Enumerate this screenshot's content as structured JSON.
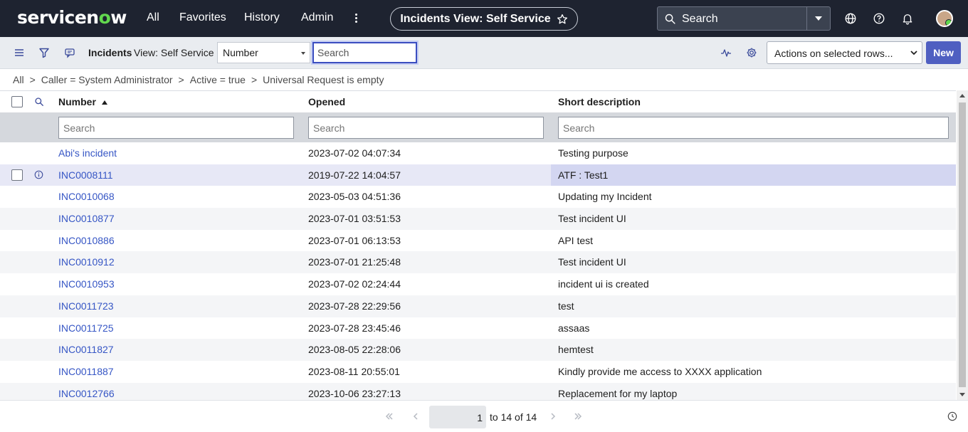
{
  "nav": {
    "logo_pre": "servicen",
    "logo_o": "o",
    "logo_post": "w",
    "links": [
      "All",
      "Favorites",
      "History",
      "Admin"
    ],
    "title": "Incidents View: Self Service",
    "search_placeholder": "Search"
  },
  "listbar": {
    "title": "Incidents",
    "view": "View: Self Service",
    "field_select": "Number",
    "search_placeholder": "Search",
    "actions_select": "Actions on selected rows...",
    "new_label": "New"
  },
  "breadcrumb": [
    "All",
    "Caller = System Administrator",
    "Active = true",
    "Universal Request is empty"
  ],
  "table": {
    "columns": [
      "Number",
      "Opened",
      "Short description"
    ],
    "filter_placeholders": [
      "Search",
      "Search",
      "Search"
    ],
    "rows": [
      {
        "number": "Abi's incident",
        "opened": "2023-07-02 04:07:34",
        "desc": "Testing purpose"
      },
      {
        "number": "INC0008111",
        "opened": "2019-07-22 14:04:57",
        "desc": "ATF : Test1"
      },
      {
        "number": "INC0010068",
        "opened": "2023-05-03 04:51:36",
        "desc": "Updating my Incident"
      },
      {
        "number": "INC0010877",
        "opened": "2023-07-01 03:51:53",
        "desc": "Test incident UI"
      },
      {
        "number": "INC0010886",
        "opened": "2023-07-01 06:13:53",
        "desc": "API test"
      },
      {
        "number": "INC0010912",
        "opened": "2023-07-01 21:25:48",
        "desc": "Test incident UI"
      },
      {
        "number": "INC0010953",
        "opened": "2023-07-02 02:24:44",
        "desc": "incident ui is created"
      },
      {
        "number": "INC0011723",
        "opened": "2023-07-28 22:29:56",
        "desc": "test"
      },
      {
        "number": "INC0011725",
        "opened": "2023-07-28 23:45:46",
        "desc": "assaas"
      },
      {
        "number": "INC0011827",
        "opened": "2023-08-05 22:28:06",
        "desc": "hemtest"
      },
      {
        "number": "INC0011887",
        "opened": "2023-08-11 20:55:01",
        "desc": "Kindly provide me access to XXXX application"
      },
      {
        "number": "INC0012766",
        "opened": "2023-10-06 23:27:13",
        "desc": "Replacement for my laptop"
      }
    ]
  },
  "pagination": {
    "page": "1",
    "text": "to 14 of 14"
  },
  "colors": {
    "nav_bg": "#1e2330",
    "accent": "#4f5fc1",
    "link": "#3656c5",
    "logo_green": "#62d84e"
  }
}
